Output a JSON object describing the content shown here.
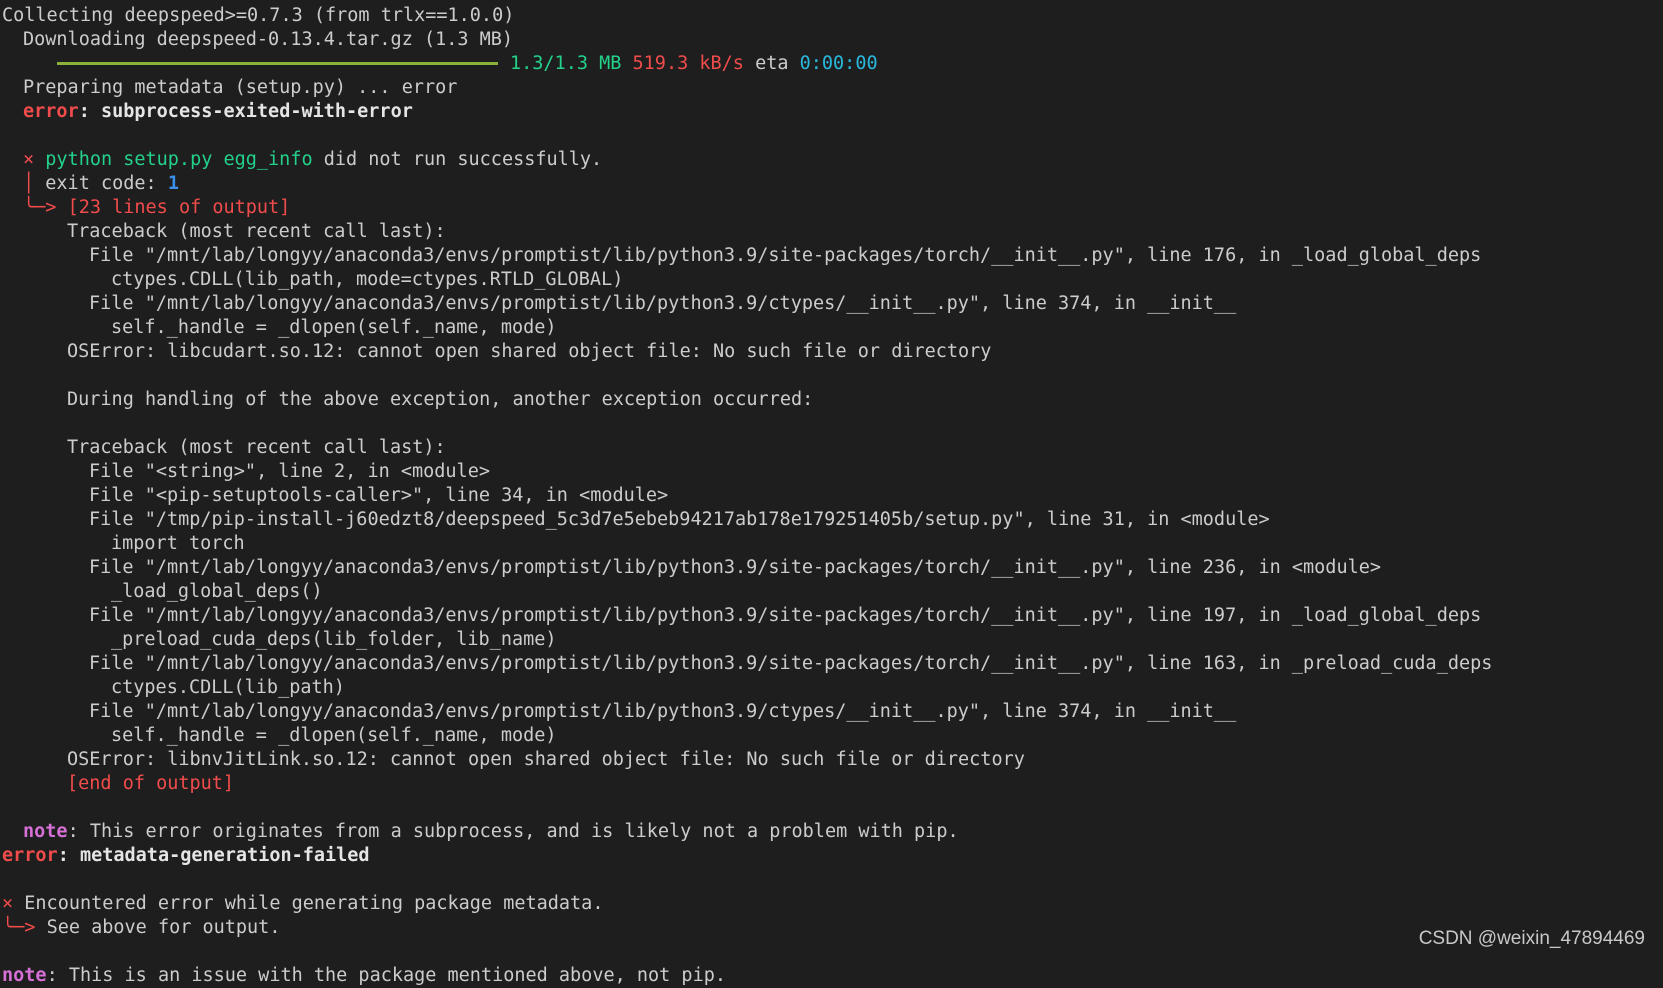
{
  "terminal": {
    "collecting": "Collecting deepspeed>=0.7.3 (from trlx==1.0.0)",
    "downloading": "Downloading deepspeed-0.13.4.tar.gz (1.3 MB)",
    "progress": {
      "fraction": 1.0,
      "size": "1.3/1.3 MB",
      "speed": "519.3 kB/s",
      "eta_label": "eta",
      "eta": "0:00:00",
      "bar_color": "#8ab23a"
    },
    "preparing": "Preparing metadata (setup.py) ... error",
    "error_label": "error",
    "error1_msg": "subprocess-exited-with-error",
    "x_mark": "×",
    "cmd": "python setup.py egg_info",
    "cmd_suffix": " did not run successfully.",
    "exit_label": "exit code: ",
    "exit_code": "1",
    "output_lines": "[23 lines of output]",
    "tb_header": "Traceback (most recent call last):",
    "tb1": [
      "File \"/mnt/lab/longyy/anaconda3/envs/promptist/lib/python3.9/site-packages/torch/__init__.py\", line 176, in _load_global_deps",
      "ctypes.CDLL(lib_path, mode=ctypes.RTLD_GLOBAL)",
      "File \"/mnt/lab/longyy/anaconda3/envs/promptist/lib/python3.9/ctypes/__init__.py\", line 374, in __init__",
      "self._handle = _dlopen(self._name, mode)"
    ],
    "oserror1": "OSError: libcudart.so.12: cannot open shared object file: No such file or directory",
    "during": "During handling of the above exception, another exception occurred:",
    "tb2": [
      "File \"<string>\", line 2, in <module>",
      "File \"<pip-setuptools-caller>\", line 34, in <module>",
      "File \"/tmp/pip-install-j60edzt8/deepspeed_5c3d7e5ebeb94217ab178e179251405b/setup.py\", line 31, in <module>",
      "import torch",
      "File \"/mnt/lab/longyy/anaconda3/envs/promptist/lib/python3.9/site-packages/torch/__init__.py\", line 236, in <module>",
      "_load_global_deps()",
      "File \"/mnt/lab/longyy/anaconda3/envs/promptist/lib/python3.9/site-packages/torch/__init__.py\", line 197, in _load_global_deps",
      "_preload_cuda_deps(lib_folder, lib_name)",
      "File \"/mnt/lab/longyy/anaconda3/envs/promptist/lib/python3.9/site-packages/torch/__init__.py\", line 163, in _preload_cuda_deps",
      "ctypes.CDLL(lib_path)",
      "File \"/mnt/lab/longyy/anaconda3/envs/promptist/lib/python3.9/ctypes/__init__.py\", line 374, in __init__",
      "self._handle = _dlopen(self._name, mode)"
    ],
    "oserror2": "OSError: libnvJitLink.so.12: cannot open shared object file: No such file or directory",
    "end_output": "[end of output]",
    "note_label": "note",
    "note1": ": This error originates from a subprocess, and is likely not a problem with pip.",
    "error2_msg": "metadata-generation-failed",
    "encountered": "Encountered error while generating package metadata.",
    "see_above": "See above for output.",
    "note2": ": This is an issue with the package mentioned above, not pip."
  },
  "watermark": "CSDN @weixin_47894469"
}
